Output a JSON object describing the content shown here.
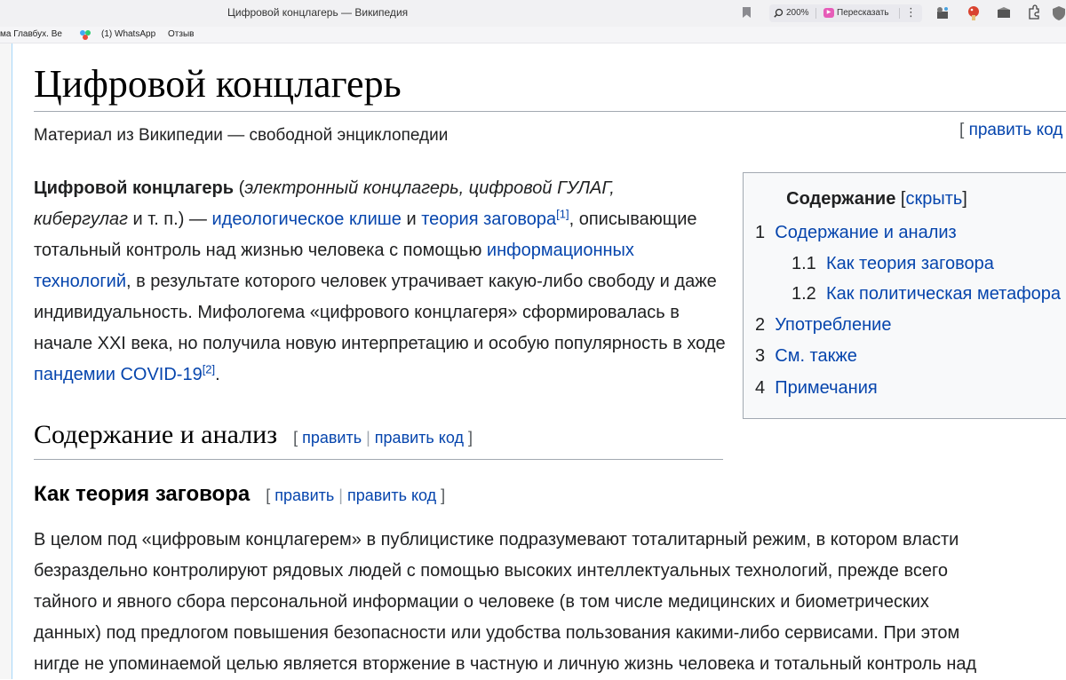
{
  "browser": {
    "tab_title": "Цифровой концлагерь — Википедия",
    "zoom": "200%",
    "retell_label": "Пересказать",
    "kebab": "⋮",
    "bookmarks": [
      "ма Главбух. Ве",
      "(1) WhatsApp",
      "Отзыв"
    ]
  },
  "article": {
    "title": "Цифровой концлагерь",
    "tagline": "Материал из Википедии — свободной энциклопедии",
    "edit_top_open": "[ ",
    "edit_top_label": "править код",
    "lead": {
      "bold_term": "Цифровой концлагерь",
      "paren_open": " (",
      "alt_names_1": "электронный концлагерь, цифровой ГУЛАГ,",
      "alt_names_2": "кибергулаг",
      "after_alt": " и т. п.) — ",
      "link_cliche": "идеологическое клише",
      "and": " и ",
      "link_conspiracy": "теория заговора",
      "ref1": "[1]",
      "comma": ",",
      "text_1": " описывающие тотальный контроль над жизнью человека с помощью ",
      "link_it": "информационных технологий",
      "text_2": ", в результате которого человек утрачивает какую-либо свободу и даже индивидуальность. Мифологема «цифрового концлагеря» сформировалась в начале XXI века, но получила новую интерпретацию и особую популярность в ходе ",
      "link_covid": "пандемии COVID-19",
      "ref2": "[2]",
      "end": "."
    },
    "toc": {
      "title": "Содержание",
      "toggle_open": " [",
      "toggle_label": "скрыть",
      "toggle_close": "]",
      "items": [
        {
          "num": "1",
          "label": "Содержание и анализ"
        },
        {
          "num": "1.1",
          "label": "Как теория заговора"
        },
        {
          "num": "1.2",
          "label": "Как политическая метафора"
        },
        {
          "num": "2",
          "label": "Употребление"
        },
        {
          "num": "3",
          "label": "См. также"
        },
        {
          "num": "4",
          "label": "Примечания"
        }
      ]
    },
    "section": {
      "title": "Содержание и анализ",
      "edit_open": "[ ",
      "edit_label": "править",
      "edit_sep": " | ",
      "edit_code_label": "править код",
      "edit_close": " ]"
    },
    "subsection": {
      "title": "Как теория заговора",
      "edit_open": "[ ",
      "edit_label": "править",
      "edit_sep": " | ",
      "edit_code_label": "править код",
      "edit_close": " ]"
    },
    "body_lines": [
      "В целом под «цифровым концлагерем» в публицистике подразумевают тоталитарный режим, в котором власти",
      "безраздельно контролируют рядовых людей с помощью высоких интеллектуальных технологий, прежде всего",
      "тайного и явного сбора персональной информации о человеке (в том числе медицинских и биометрических",
      "данных) под предлогом повышения безопасности или удобства пользования какими-либо сервисами. При этом",
      "нигде не упоминаемой целью является вторжение в частную и личную жизнь человека и тотальный контроль над"
    ]
  },
  "colors": {
    "link": "#0645ad",
    "text": "#202122",
    "border": "#a2a9b1",
    "toc_bg": "#f8f9fa"
  }
}
